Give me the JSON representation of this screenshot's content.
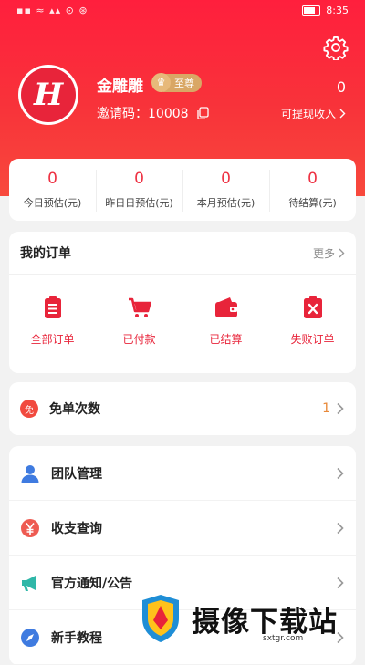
{
  "status_bar": {
    "left": "▪▪ ≈ ▴▴ ⊙ ⊛",
    "time": "8:35"
  },
  "colors": {
    "brand_red": "#f8333a",
    "accent_gold": "#d9a765",
    "count_orange": "#e8893a"
  },
  "profile": {
    "avatar_letter": "H",
    "username": "金雕雕",
    "vip_label": "至尊",
    "invite_label": "邀请码：",
    "invite_code": "10008",
    "balance": "0",
    "withdraw_label": "可提现收入"
  },
  "stats": [
    {
      "value": "0",
      "label": "今日预估(元)"
    },
    {
      "value": "0",
      "label": "昨日日预估(元)"
    },
    {
      "value": "0",
      "label": "本月预估(元)"
    },
    {
      "value": "0",
      "label": "待结算(元)"
    }
  ],
  "orders": {
    "title": "我的订单",
    "more": "更多",
    "items": [
      {
        "label": "全部订单",
        "icon": "clipboard-list-icon"
      },
      {
        "label": "已付款",
        "icon": "cart-icon"
      },
      {
        "label": "已结算",
        "icon": "wallet-icon"
      },
      {
        "label": "失败订单",
        "icon": "clipboard-x-icon"
      }
    ]
  },
  "free_orders": {
    "badge": "免",
    "label": "免单次数",
    "count": "1"
  },
  "menu": [
    {
      "label": "团队管理",
      "icon": "team-icon"
    },
    {
      "label": "收支查询",
      "icon": "yen-icon"
    },
    {
      "label": "官方通知/公告",
      "icon": "megaphone-icon"
    },
    {
      "label": "新手教程",
      "icon": "compass-icon"
    }
  ],
  "watermark": {
    "text": "摄像下载站",
    "url": "sxtgr.com"
  }
}
